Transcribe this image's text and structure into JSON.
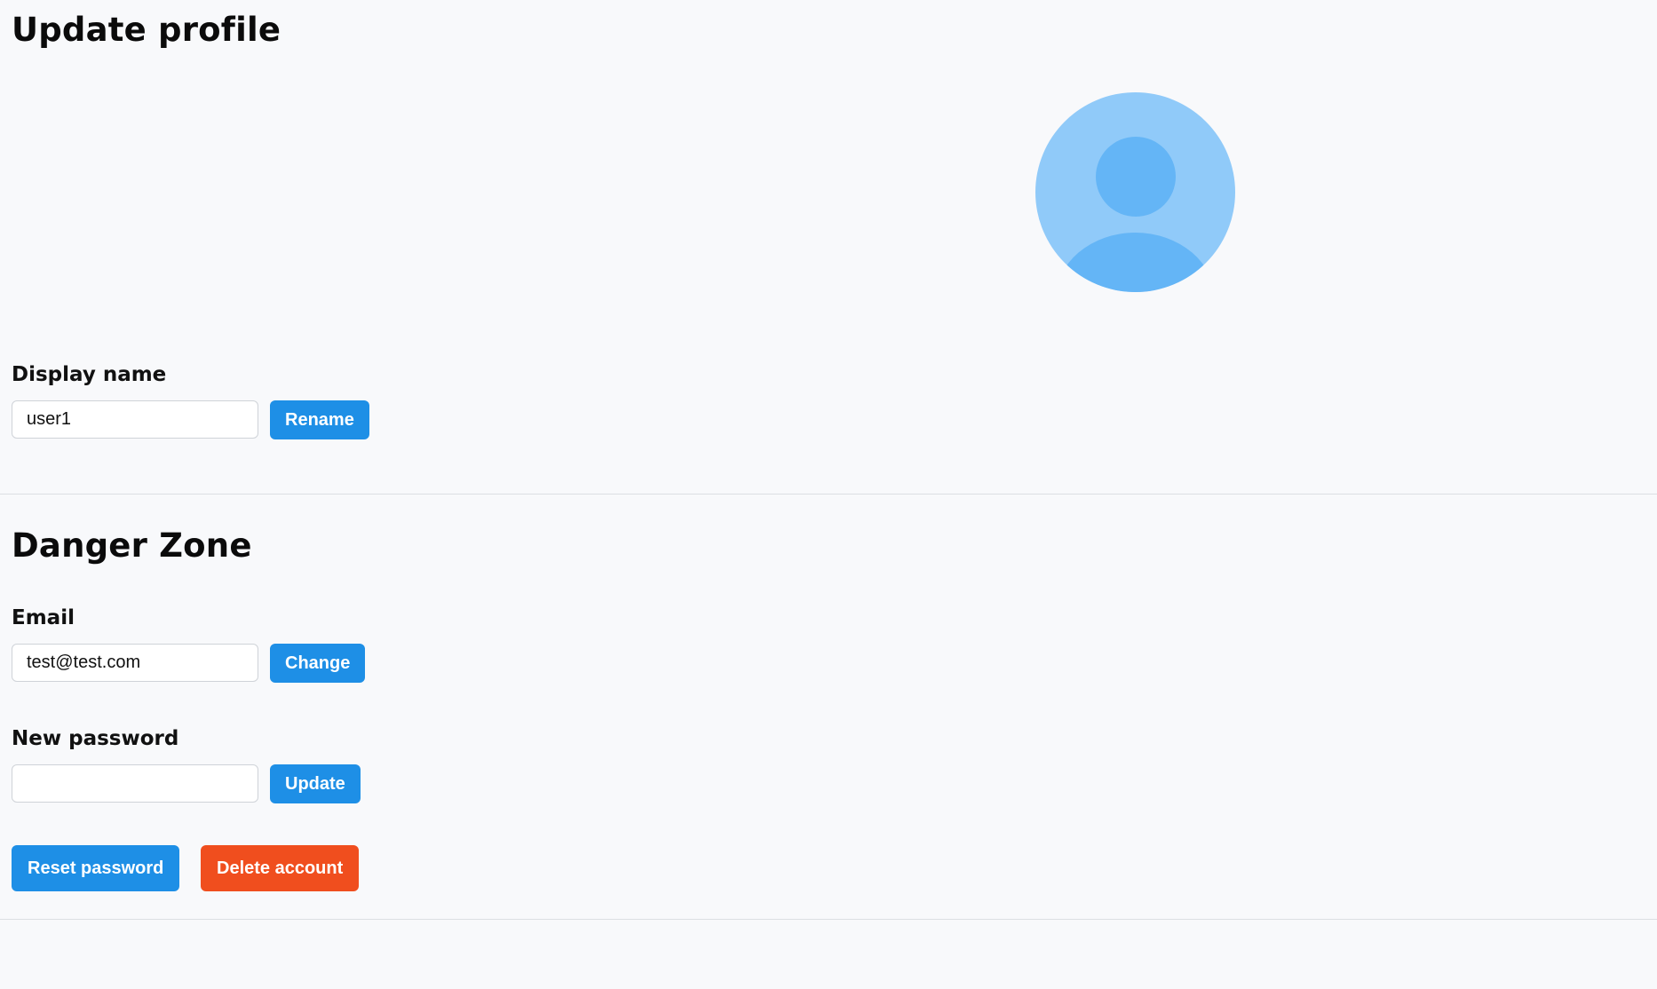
{
  "profile": {
    "title": "Update profile",
    "avatar_icon": "user-avatar-icon",
    "display_name_label": "Display name",
    "display_name_value": "user1",
    "rename_label": "Rename"
  },
  "danger_zone": {
    "title": "Danger Zone",
    "email_label": "Email",
    "email_value": "test@test.com",
    "change_label": "Change",
    "password_label": "New password",
    "password_value": "",
    "update_label": "Update",
    "reset_password_label": "Reset password",
    "delete_account_label": "Delete account"
  },
  "colors": {
    "background": "#f8f9fb",
    "primary_button": "#1e8fe6",
    "danger_button": "#f04e1e",
    "avatar_bg": "#90caf9",
    "avatar_fg": "#64b5f6"
  }
}
